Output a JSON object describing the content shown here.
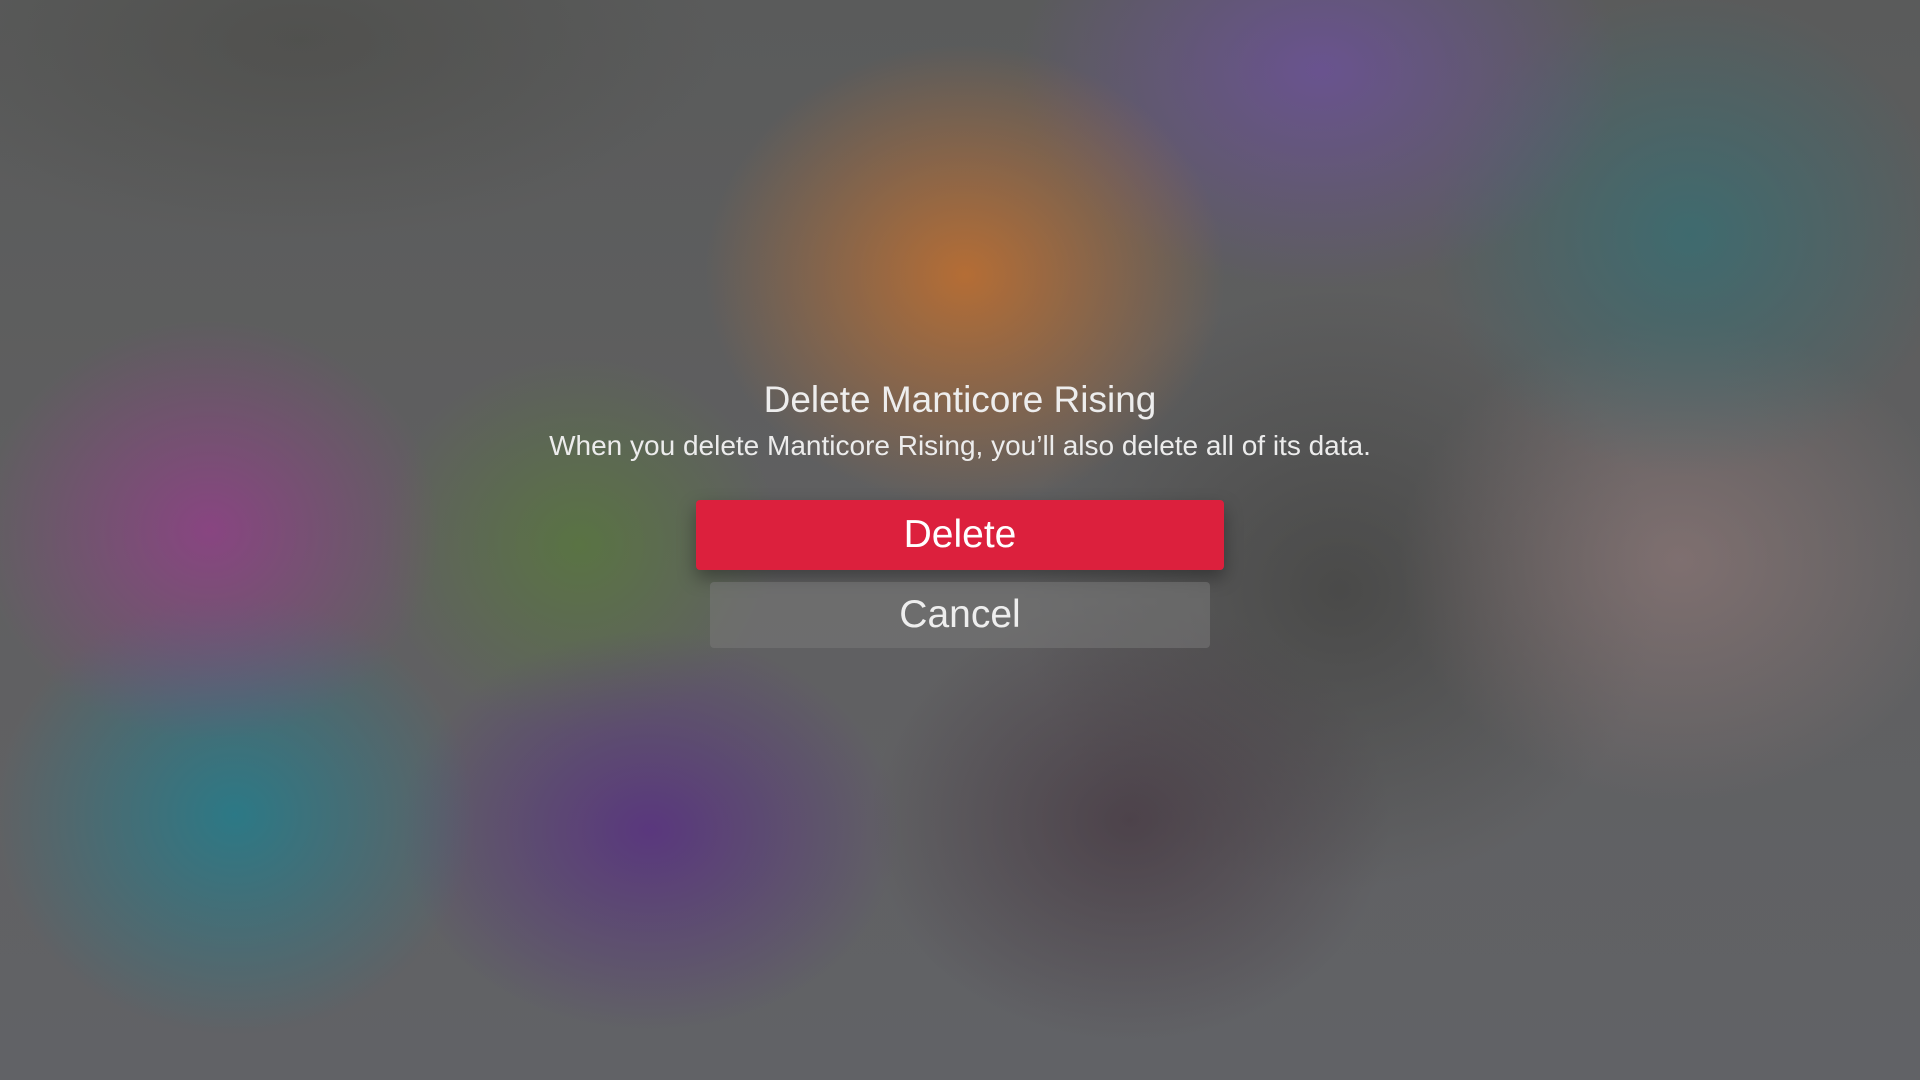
{
  "dialog": {
    "title": "Delete Manticore Rising",
    "message": "When you delete Manticore Rising, you’ll also delete all of its data.",
    "delete_label": "Delete",
    "cancel_label": "Cancel"
  },
  "colors": {
    "delete_button": "#dc203d",
    "cancel_button": "#787878",
    "text": "#f2f2f2"
  }
}
